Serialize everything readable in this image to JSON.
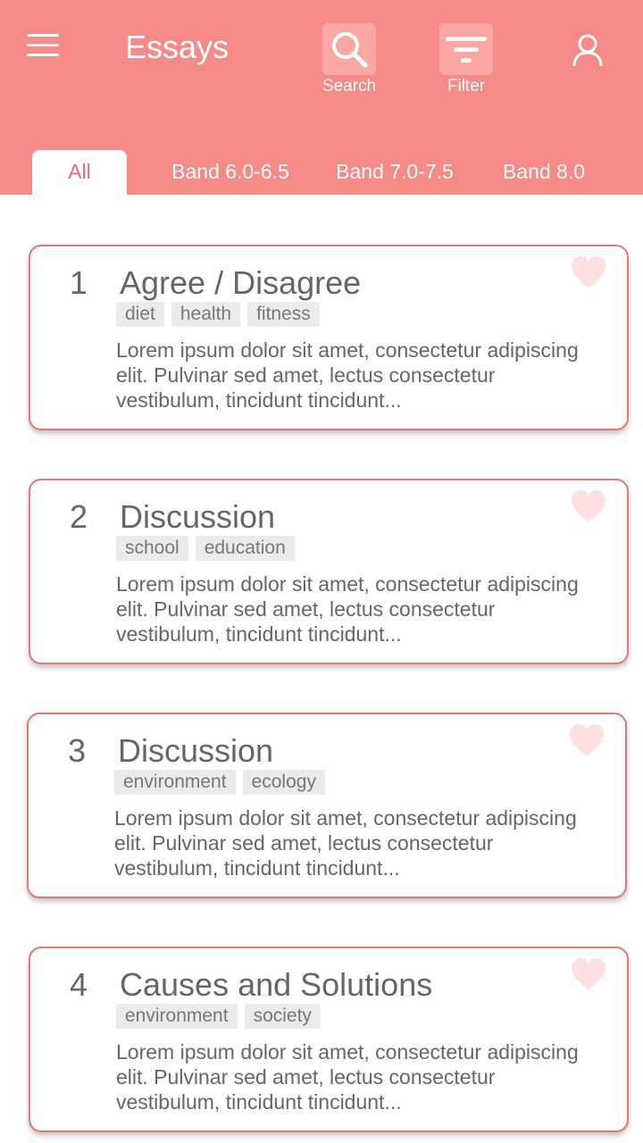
{
  "header": {
    "title": "Essays",
    "search_label": "Search",
    "filter_label": "Filter",
    "color": "#f58a87"
  },
  "tabs": [
    {
      "label": "All",
      "active": true
    },
    {
      "label": "Band 6.0-6.5",
      "active": false
    },
    {
      "label": "Band 7.0-7.5",
      "active": false
    },
    {
      "label": "Band 8.0",
      "active": false
    }
  ],
  "essays": [
    {
      "number": "1",
      "title": "Agree / Disagree",
      "tags": [
        "diet",
        "health",
        "fitness"
      ],
      "excerpt": "Lorem ipsum dolor sit amet, consectetur adipiscing elit. Pulvinar sed amet, lectus consectetur vestibulum, tincidunt tincidunt..."
    },
    {
      "number": "2",
      "title": "Discussion",
      "tags": [
        "school",
        "education"
      ],
      "excerpt": "Lorem ipsum dolor sit amet, consectetur adipiscing elit. Pulvinar sed amet, lectus consectetur vestibulum, tincidunt tincidunt..."
    },
    {
      "number": "3",
      "title": "Discussion",
      "tags": [
        "environment",
        "ecology"
      ],
      "excerpt": "Lorem ipsum dolor sit amet, consectetur adipiscing elit. Pulvinar sed amet, lectus consectetur vestibulum, tincidunt tincidunt..."
    },
    {
      "number": "4",
      "title": "Causes and Solutions",
      "tags": [
        "environment",
        "society"
      ],
      "excerpt": "Lorem ipsum dolor sit amet, consectetur adipiscing elit. Pulvinar sed amet, lectus consectetur vestibulum, tincidunt tincidunt..."
    }
  ],
  "icons": {
    "menu": "hamburger-menu-icon",
    "search": "search-icon",
    "filter": "filter-icon",
    "user": "user-icon",
    "favorite": "heart-icon"
  },
  "colors": {
    "accent": "#f58a87",
    "tile": "#fba8a5",
    "card_border": "#e27874",
    "heart": "#fde0df",
    "tag_bg": "#ebebeb"
  }
}
